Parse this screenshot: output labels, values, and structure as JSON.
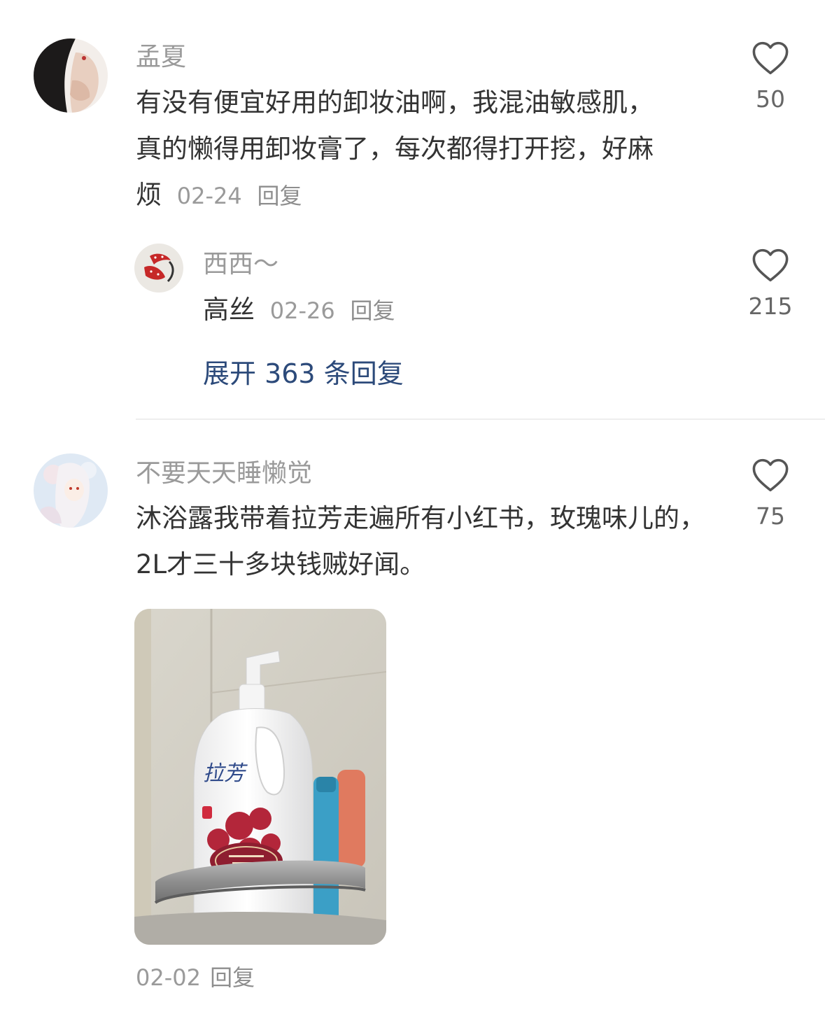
{
  "comments": [
    {
      "author": "孟夏",
      "text": "有没有便宜好用的卸妆油啊，我混油敏感肌，真的懒得用卸妆膏了，每次都得打开挖，好麻烦",
      "date": "02-24",
      "reply_label": "回复",
      "likes": "50",
      "sub_reply": {
        "author": "西西～",
        "text": "高丝",
        "date": "02-26",
        "reply_label": "回复",
        "likes": "215"
      },
      "expand_label": "展开 363 条回复"
    },
    {
      "author": "不要天天睡懒觉",
      "text": "沐浴露我带着拉芳走遍所有小红书，玫瑰味儿的，2L才三十多块钱贼好闻。",
      "date": "02-02",
      "reply_label": "回复",
      "likes": "75",
      "image_brand": "拉芳"
    }
  ],
  "icons": {
    "like": "heart-outline-icon"
  },
  "colors": {
    "link": "#2c4a7a",
    "muted": "#9a9a9a",
    "text": "#333333"
  }
}
